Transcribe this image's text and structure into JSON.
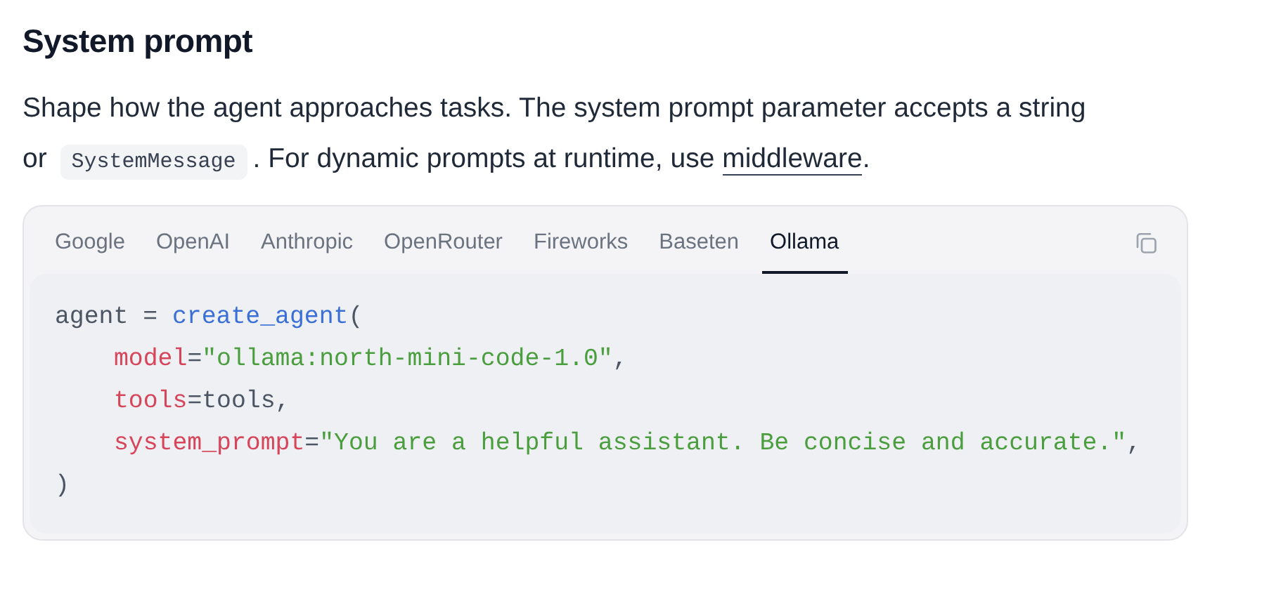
{
  "heading": "System prompt",
  "paragraph": [
    {
      "kind": "text",
      "text": "Shape how the agent approaches tasks. The system prompt parameter accepts a string or "
    },
    {
      "kind": "code",
      "text": "SystemMessage"
    },
    {
      "kind": "text",
      "text": ". For dynamic prompts at runtime, use "
    },
    {
      "kind": "link",
      "text": "middleware"
    },
    {
      "kind": "text",
      "text": "."
    }
  ],
  "code_block": {
    "tabs": [
      {
        "label": "Google",
        "selected": false
      },
      {
        "label": "OpenAI",
        "selected": false
      },
      {
        "label": "Anthropic",
        "selected": false
      },
      {
        "label": "OpenRouter",
        "selected": false
      },
      {
        "label": "Fireworks",
        "selected": false
      },
      {
        "label": "Baseten",
        "selected": false
      },
      {
        "label": "Ollama",
        "selected": true
      }
    ],
    "lines": [
      {
        "tokens": [
          {
            "kind": "plain",
            "text": "agent = "
          },
          {
            "kind": "func",
            "text": "create_agent"
          },
          {
            "kind": "plain",
            "text": "("
          }
        ],
        "children": [
          {
            "tokens": [
              {
                "kind": "key",
                "text": "model"
              },
              {
                "kind": "plain",
                "text": "="
              },
              {
                "kind": "string",
                "text": "\"ollama:north-mini-code-1.0\""
              },
              {
                "kind": "plain",
                "text": ","
              }
            ]
          },
          {
            "tokens": [
              {
                "kind": "key",
                "text": "tools"
              },
              {
                "kind": "plain",
                "text": "=tools,"
              }
            ]
          },
          {
            "tokens": [
              {
                "kind": "key",
                "text": "system_prompt"
              },
              {
                "kind": "plain",
                "text": "="
              },
              {
                "kind": "string",
                "text": "\"You are a helpful assistant. Be concise and accurate.\""
              },
              {
                "kind": "plain",
                "text": ","
              }
            ]
          }
        ]
      },
      {
        "tokens": [
          {
            "kind": "plain",
            "text": ")"
          }
        ]
      }
    ]
  }
}
